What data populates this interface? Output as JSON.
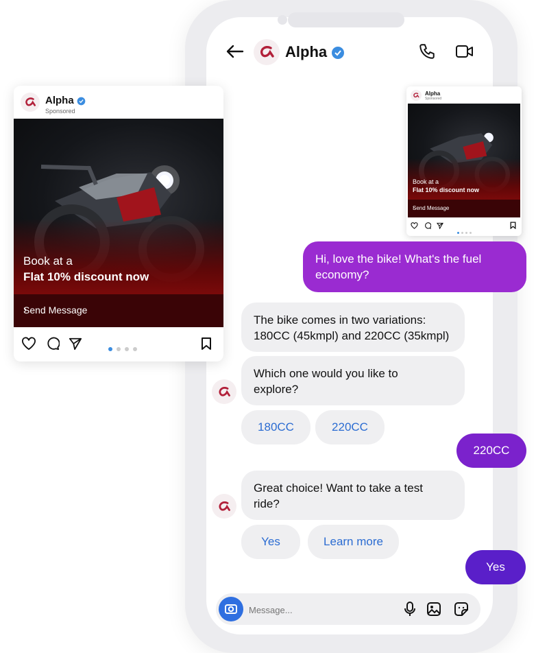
{
  "header": {
    "name": "Alpha"
  },
  "ad_card": {
    "name": "Alpha",
    "sponsored": "Sponsored",
    "line1": "Book at a",
    "line2": "Flat 10% discount now",
    "cta": "Send Message"
  },
  "mini_card": {
    "name": "Alpha",
    "sponsored": "Sponsored",
    "line1": "Book at a",
    "line2": "Flat 10% discount now",
    "cta": "Send Message"
  },
  "messages": {
    "user_1": "Hi, love the bike! What's the fuel economy?",
    "bot_1": "The bike comes in two variations: 180CC (45kmpl) and 220CC (35kmpl)",
    "bot_2": "Which one would you like to explore?",
    "quick_replies_1": [
      "180CC",
      "220CC"
    ],
    "user_2": "220CC",
    "bot_3": "Great choice! Want to take a test ride?",
    "quick_replies_2": [
      "Yes",
      "Learn more"
    ],
    "user_3": "Yes"
  },
  "composer": {
    "placeholder": "Message..."
  },
  "colors": {
    "user_bubble": "#9a2bd1",
    "user_bubble_dark": "#5a1fc9",
    "bot_bubble": "#efeff1",
    "link": "#2b6cd2",
    "brand": "#b2203a",
    "verified": "#3b8de0"
  }
}
